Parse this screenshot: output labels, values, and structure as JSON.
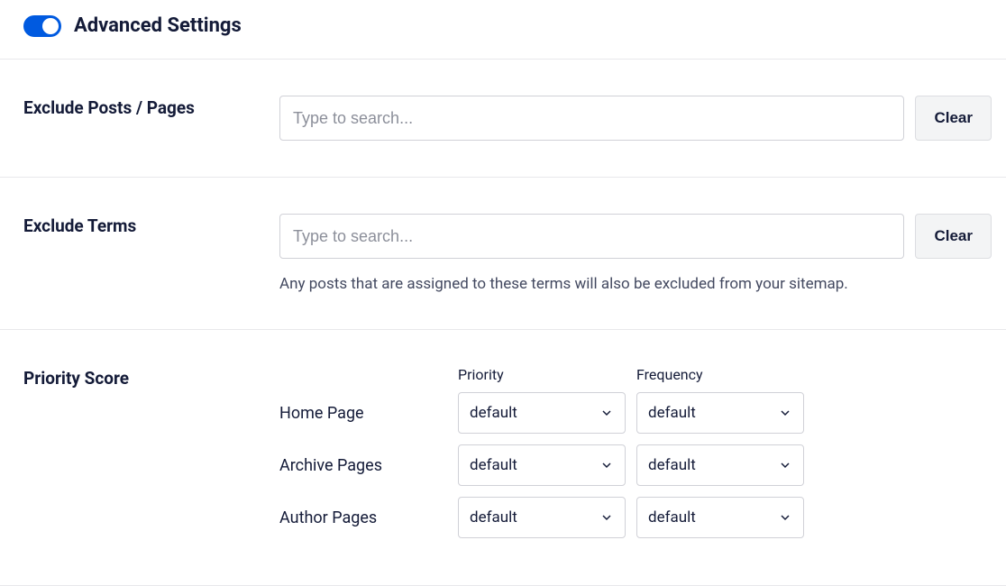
{
  "header": {
    "title": "Advanced Settings",
    "toggle_on": true
  },
  "exclude_posts": {
    "label": "Exclude Posts / Pages",
    "placeholder": "Type to search...",
    "clear_label": "Clear"
  },
  "exclude_terms": {
    "label": "Exclude Terms",
    "placeholder": "Type to search...",
    "clear_label": "Clear",
    "helper": "Any posts that are assigned to these terms will also be excluded from your sitemap."
  },
  "priority_score": {
    "label": "Priority Score",
    "columns": {
      "priority": "Priority",
      "frequency": "Frequency"
    },
    "rows": [
      {
        "label": "Home Page",
        "priority": "default",
        "frequency": "default"
      },
      {
        "label": "Archive Pages",
        "priority": "default",
        "frequency": "default"
      },
      {
        "label": "Author Pages",
        "priority": "default",
        "frequency": "default"
      }
    ]
  }
}
